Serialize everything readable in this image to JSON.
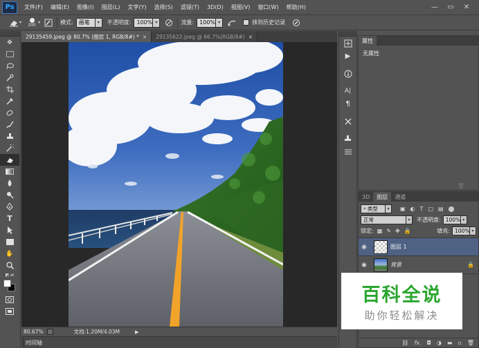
{
  "app": {
    "logo": "Ps"
  },
  "menu": [
    "文件(F)",
    "编辑(E)",
    "图像(I)",
    "图层(L)",
    "文字(Y)",
    "选择(S)",
    "滤镜(T)",
    "3D(D)",
    "视图(V)",
    "窗口(W)",
    "帮助(H)"
  ],
  "window_controls": {
    "minimize": "—",
    "restore": "▭",
    "close": "✕"
  },
  "options": {
    "brush_size": "200",
    "mode_label": "模式:",
    "mode_value": "画笔",
    "opacity_label": "不透明度:",
    "opacity_value": "100%",
    "flow_label": "流量:",
    "flow_value": "100%",
    "history_label": "抹到历史记录"
  },
  "tabs": [
    {
      "label": "29135459.jpeg @ 80.7% (图层 1, RGB/8#) *",
      "close": "×",
      "active": true
    },
    {
      "label": "29135622.jpeg @ 66.7%(RGB/8#)",
      "close": "×",
      "active": false
    }
  ],
  "status": {
    "zoom": "80.67%",
    "doc": "文档:1.20M/4.03M",
    "arrow": "▶"
  },
  "timeline": {
    "label": "时间轴"
  },
  "properties": {
    "tab": "属性",
    "empty": "无属性"
  },
  "layers_panel": {
    "tabs": [
      "3D",
      "图层",
      "通道"
    ],
    "filter_kind": "类型",
    "blend_mode": "正常",
    "opacity_label": "不透明度:",
    "opacity_value": "100%",
    "lock_label": "锁定:",
    "fill_label": "填充:",
    "fill_value": "100%",
    "layers": [
      {
        "name": "图层 1",
        "selected": true
      },
      {
        "name": "背景",
        "selected": false
      }
    ],
    "footer_icons": [
      "link-icon",
      "fx-icon",
      "mask-icon",
      "adjustment-icon",
      "folder-icon",
      "new-layer-icon",
      "trash-icon"
    ]
  },
  "watermark": {
    "title": "百科全说",
    "subtitle": "助你轻松解决"
  },
  "colors": {
    "ui_bg": "#535353",
    "canvas_bg": "#282828",
    "selected_layer": "#4f6284",
    "watermark_green": "#2aa62e"
  }
}
